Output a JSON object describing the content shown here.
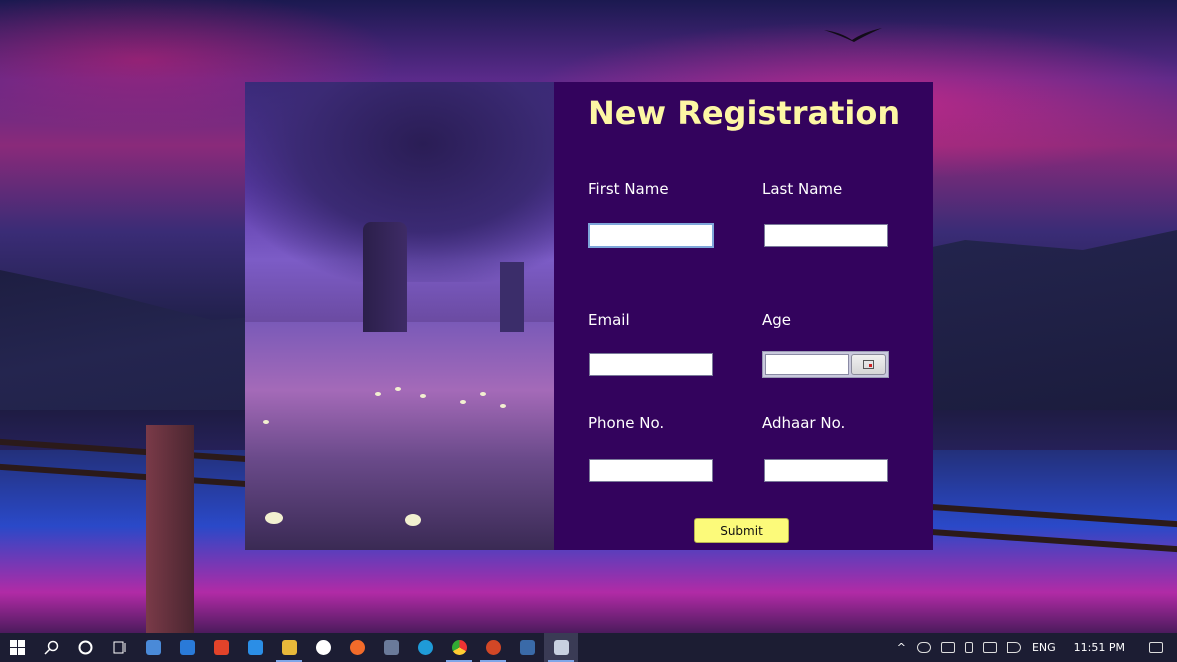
{
  "form": {
    "title": "New Registration",
    "fields": {
      "first_name": {
        "label": "First Name",
        "value": ""
      },
      "last_name": {
        "label": "Last Name",
        "value": ""
      },
      "email": {
        "label": "Email",
        "value": ""
      },
      "age": {
        "label": "Age",
        "value": ""
      },
      "phone": {
        "label": "Phone No.",
        "value": ""
      },
      "adhaar": {
        "label": "Adhaar No.",
        "value": ""
      }
    },
    "submit_label": "Submit"
  },
  "colors": {
    "form_bg": "#33035d",
    "title": "#fdf7a4",
    "submit_bg": "#fcfa7a"
  },
  "taskbar": {
    "items": [
      "windows-start-icon",
      "search-icon",
      "cortana-icon",
      "task-view-icon",
      "store-icon",
      "mail-icon",
      "office-icon",
      "vscode-icon",
      "app-icon",
      "app-icon",
      "app-icon",
      "photos-icon",
      "edge-icon",
      "chrome-icon",
      "powerpoint-icon",
      "app-icon",
      "app-icon"
    ],
    "tray": {
      "language": "ENG",
      "time": "11:51 PM"
    }
  }
}
